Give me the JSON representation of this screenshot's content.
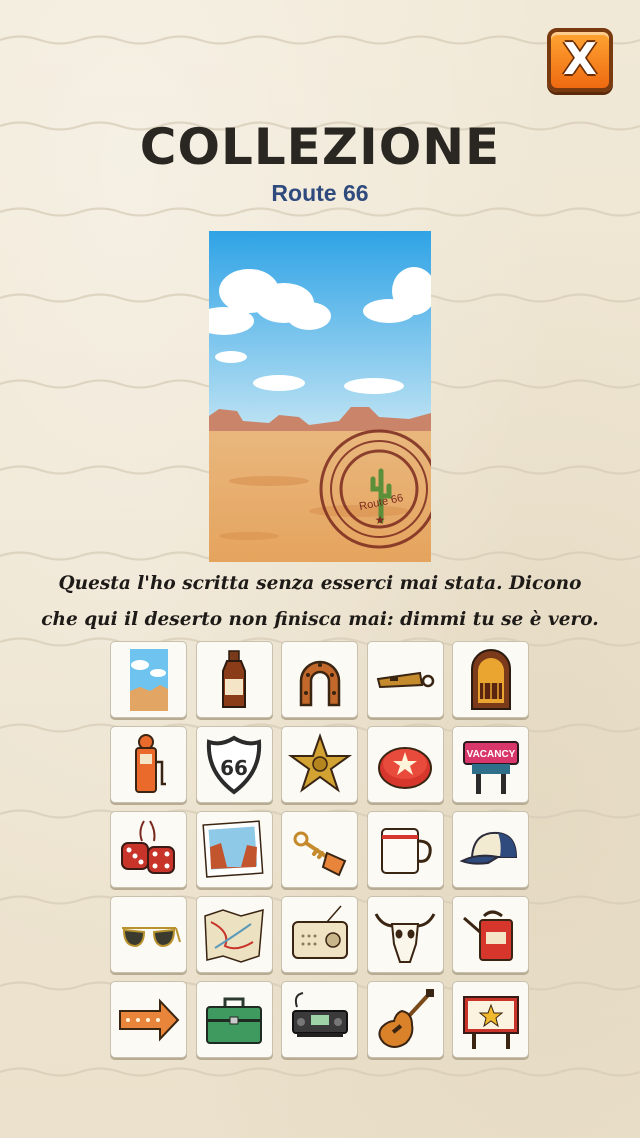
{
  "header": {
    "title": "COLLEZIONE",
    "subtitle": "Route 66",
    "close_label": "X"
  },
  "postcard": {
    "stamp_text": "Route 66"
  },
  "description": {
    "line1": "Questa l'ho scritta senza esserci mai stata. Dicono",
    "line2": "che qui il deserto non finisca mai: dimmi tu se è vero."
  },
  "items": [
    {
      "icon": "desert-postcard-icon"
    },
    {
      "icon": "bottle-icon"
    },
    {
      "icon": "horseshoe-icon"
    },
    {
      "icon": "whistle-icon"
    },
    {
      "icon": "jukebox-icon"
    },
    {
      "icon": "gas-pump-icon"
    },
    {
      "icon": "route-66-shield-icon",
      "label": "66"
    },
    {
      "icon": "sheriff-star-icon"
    },
    {
      "icon": "bottle-cap-icon"
    },
    {
      "icon": "vacancy-sign-icon",
      "label": "VACANCY"
    },
    {
      "icon": "fuzzy-dice-icon"
    },
    {
      "icon": "canyon-photo-icon"
    },
    {
      "icon": "motel-key-icon"
    },
    {
      "icon": "coffee-mug-icon"
    },
    {
      "icon": "trucker-cap-icon"
    },
    {
      "icon": "aviator-sunglasses-icon"
    },
    {
      "icon": "road-map-icon"
    },
    {
      "icon": "radio-icon"
    },
    {
      "icon": "cow-skull-icon"
    },
    {
      "icon": "oil-can-icon"
    },
    {
      "icon": "arrow-sign-icon"
    },
    {
      "icon": "toolbox-icon"
    },
    {
      "icon": "cb-radio-icon"
    },
    {
      "icon": "electric-guitar-icon"
    },
    {
      "icon": "star-billboard-icon"
    }
  ],
  "colors": {
    "paper": "#efe6d3",
    "title": "#2a2622",
    "subtitle": "#2f4a7d",
    "close_button": "#ee6a10",
    "stamp": "#7a2a1f"
  }
}
